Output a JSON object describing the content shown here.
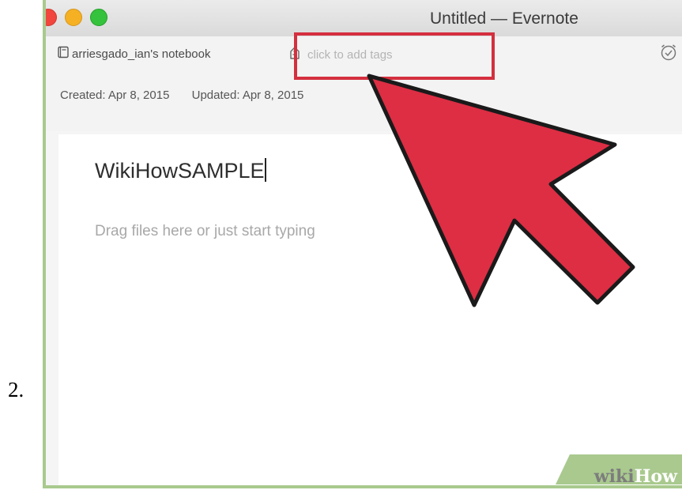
{
  "step": {
    "number": "2."
  },
  "window": {
    "title": "Untitled — Evernote",
    "traffic_lights": [
      "close",
      "minimize",
      "zoom"
    ]
  },
  "meta": {
    "notebook": "arriesgado_ian's notebook",
    "tags_placeholder": "click to add tags",
    "created": "Created: Apr 8, 2015",
    "updated": "Updated: Apr 8, 2015",
    "icons": [
      "notebook-icon",
      "tag-icon",
      "reminder-alarm-icon"
    ]
  },
  "note": {
    "title": "WikiHowSAMPLE",
    "body_placeholder": "Drag files here or just start typing"
  },
  "annotation": {
    "highlight_color": "#d42f3e",
    "arrow_color": "#dd2e44"
  },
  "watermark": {
    "part1": "wiki",
    "part2": "How"
  }
}
